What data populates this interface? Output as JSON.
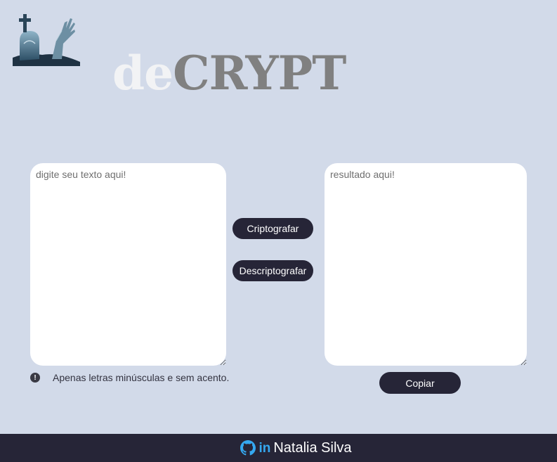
{
  "header": {
    "title_part1": "de",
    "title_part2": "CRYPT",
    "logo_icon": "graveyard-zombie-hand-icon"
  },
  "input": {
    "placeholder": "digite seu texto aqui!",
    "value": ""
  },
  "output": {
    "placeholder": "resultado aqui!",
    "value": ""
  },
  "actions": {
    "encrypt_label": "Criptografar",
    "decrypt_label": "Descriptografar",
    "copy_label": "Copiar"
  },
  "hint": {
    "icon": "exclamation-circle-icon",
    "text": "Apenas letras minúsculas e sem acento."
  },
  "footer": {
    "github_icon": "github-icon",
    "linkedin_icon": "linkedin-icon",
    "linkedin_text": "in",
    "author": "Natalia Silva"
  },
  "colors": {
    "background": "#d2dae9",
    "dark": "#262537",
    "title_light": "#f2f3f5",
    "title_gray": "#808080",
    "accent_blue": "#35a8f0"
  }
}
